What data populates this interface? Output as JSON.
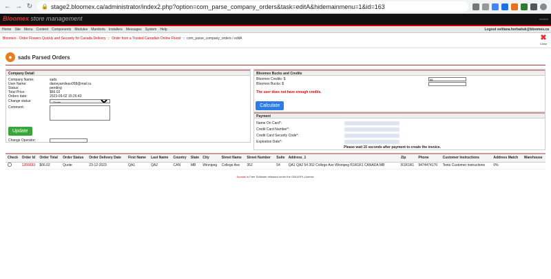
{
  "browser": {
    "url": "stage2.bloomex.ca/administrator/index2.php?option=com_parse_company_orders&task=editA&hidemainmenu=1&id=163"
  },
  "header": {
    "brand": "Bloomex",
    "subtitle": "store management",
    "version": "version"
  },
  "menu": {
    "items": [
      "Home",
      "Site",
      "Menu",
      "Content",
      "Components",
      "Modules",
      "Mambots",
      "Installers",
      "Messages",
      "System",
      "Help"
    ],
    "logout": "Logout svitlana.horbatiuk@bloomex.ca"
  },
  "breadcrumbs": {
    "items": [
      "Bloomex - Order Flowers Quickly and Securely for Canada Delivery",
      "Order from a Trusted Canadian Online Florist"
    ],
    "current": "com_parse_company_orders / editA",
    "sep": "::"
  },
  "close_label": "Close",
  "page_title": "sads Parsed Orders",
  "company": {
    "title": "Company Detail",
    "name_label": "Company Name:",
    "name": "sads",
    "user_label": "User Name:",
    "user": "danieyamileav058@mail.ru",
    "status_label": "Status:",
    "status": "pending",
    "price_label": "Total Price:",
    "price": "$66.02",
    "date_label": "Orders date:",
    "date": "2023-09-02 15:26:43",
    "change_status_label": "Change status:",
    "change_status_value": "Quote",
    "comment_label": "Comment:",
    "update_button": "Update",
    "operator_label": "Change Operator:"
  },
  "bucks": {
    "title": "Bloomex Bucks and Credits",
    "credits_label": "Bloomex Credits: $",
    "credits_value": "66",
    "bucks_label": "Bloomex Bucks: $",
    "warning": "The user does not have enough credits.",
    "calc_button": "Calculate"
  },
  "payment": {
    "title": "Payment",
    "name_label": "Name On Card*:",
    "number_label": "Credit Card Number*:",
    "cvv_label": "Credit Card Security Code*:",
    "exp_label": "Expiration Date*:",
    "note": "Please wait 15 seconds after payment to create the invoice."
  },
  "table": {
    "headers": [
      "Check",
      "Order Id",
      "Order Total",
      "Order Status",
      "Order Delivery Date",
      "First Name",
      "Last Name",
      "Country",
      "State",
      "City",
      "Street Name",
      "Street Number",
      "Suite",
      "Address_1",
      "Zip",
      "Phone",
      "Customer Instructions",
      "Address Match",
      "Warehouse"
    ],
    "rows": [
      {
        "order_id": "1266693",
        "order_total": "$66.02",
        "order_status": "Quote",
        "delivery_date": "23-12-2023",
        "first_name": "QA1",
        "last_name": "QA2",
        "country": "CAN",
        "state": "MB",
        "city": "Winnipeg",
        "street_name": "College Ave",
        "street_number": "352",
        "suite": "54",
        "address": "QA1 QA2 54 352 College Ave Winnipeg R1R1R1 CANADA MB",
        "zip": "R1R1R1",
        "phone": "9474474170",
        "instructions": "Tests Customer instructions",
        "address_match": "0%",
        "warehouse": ""
      }
    ]
  },
  "footer": {
    "link": "Joomla!",
    "text": " is Free Software released under the GNU/GPL License."
  },
  "colors": {
    "accent": "#cc0000",
    "update": "#3aa53a",
    "calculate": "#2d7be5"
  }
}
